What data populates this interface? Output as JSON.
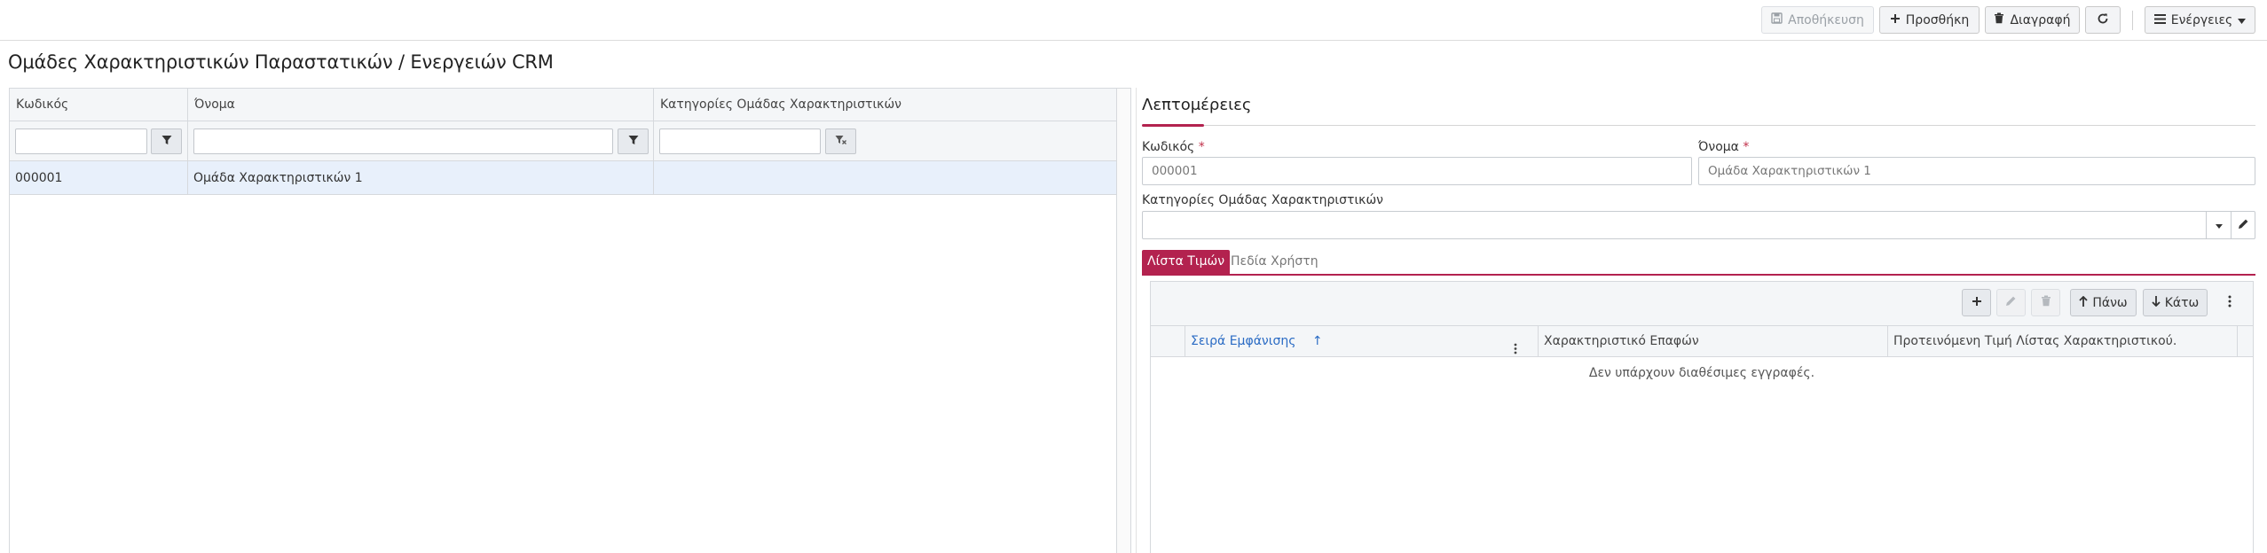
{
  "toolbar": {
    "save_label": "Αποθήκευση",
    "add_label": "Προσθήκη",
    "delete_label": "Διαγραφή",
    "actions_label": "Ενέργειες"
  },
  "page": {
    "title": "Ομάδες Χαρακτηριστικών Παραστατικών / Ενεργειών CRM"
  },
  "grid": {
    "columns": [
      "Κωδικός",
      "Όνομα",
      "Κατηγορίες Ομάδας Χαρακτηριστικών"
    ],
    "rows": [
      {
        "code": "000001",
        "name": "Ομάδα Χαρακτηριστικών 1",
        "categories": ""
      }
    ]
  },
  "details": {
    "title": "Λεπτομέρειες",
    "code_label": "Κωδικός",
    "code_value": "000001",
    "name_label": "Όνομα",
    "name_value": "Ομάδα Χαρακτηριστικών 1",
    "required_mark": "*",
    "categories_label": "Κατηγορίες Ομάδας Χαρακτηριστικών",
    "categories_value": ""
  },
  "tabs": [
    {
      "label": "Λίστα Τιμών",
      "active": true
    },
    {
      "label": "Πεδία Χρήστη",
      "active": false
    }
  ],
  "subgrid": {
    "up_label": "Πάνω",
    "down_label": "Κάτω",
    "columns": [
      "Σειρά Εμφάνισης",
      "Χαρακτηριστικό Επαφών",
      "Προτεινόμενη Τιμή Λίστας Χαρακτηριστικού."
    ],
    "sort_indicator": "↑",
    "empty_message": "Δεν υπάρχουν διαθέσιμες εγγραφές."
  },
  "colors": {
    "accent": "#b3224f",
    "link": "#2a6bc4",
    "row_selected": "#e8f0fb"
  }
}
